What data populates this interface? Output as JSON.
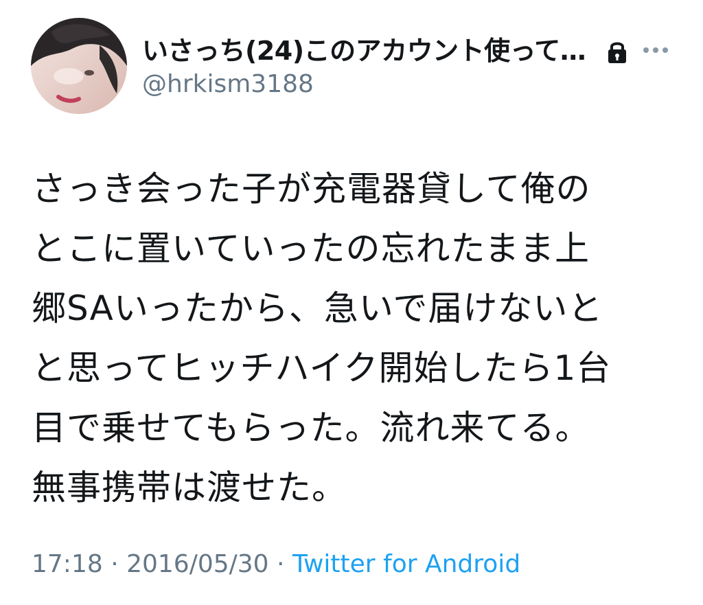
{
  "user": {
    "display_name": "いさっち(24)このアカウント使って…",
    "handle": "@hrkism3188",
    "protected_icon": "lock-icon",
    "menu_icon": "more-horizontal-icon"
  },
  "tweet": {
    "lines": [
      "さっき会った子が充電器貸して俺の",
      "とこに置いていったの忘れたまま上",
      "郷SAいったから、急いで届けないと",
      "と思ってヒッチハイク開始したら1台",
      "目で乗せてもらった。流れ来てる。",
      "無事携帯は渡せた。"
    ]
  },
  "meta": {
    "time": "17:18",
    "sep1": " · ",
    "date": "2016/05/30",
    "sep2": " · ",
    "source": "Twitter for Android"
  },
  "colors": {
    "text": "#14171a",
    "secondary": "#657786",
    "link": "#1da1f2"
  }
}
